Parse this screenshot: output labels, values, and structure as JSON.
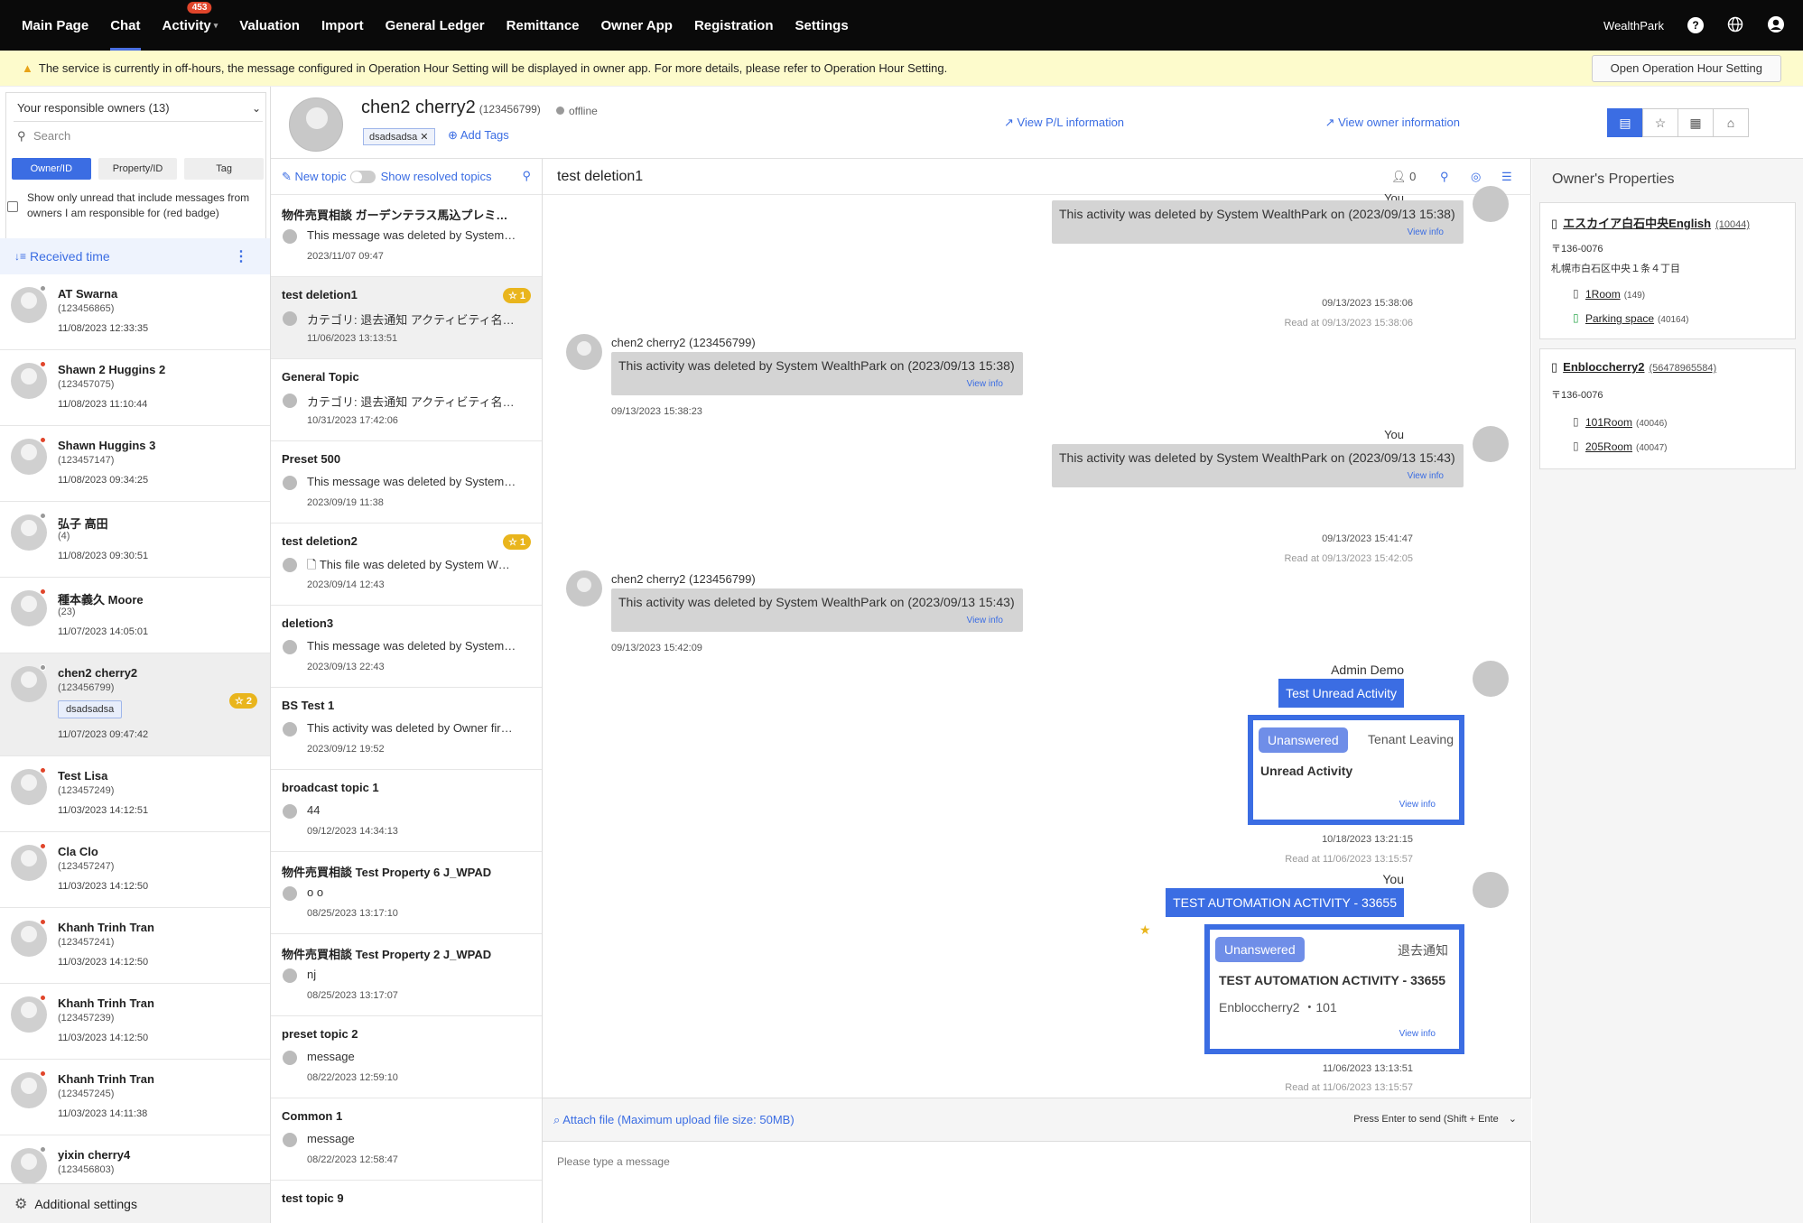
{
  "nav": {
    "items": [
      "Main Page",
      "Chat",
      "Activity",
      "Valuation",
      "Import",
      "General Ledger",
      "Remittance",
      "Owner App",
      "Registration",
      "Settings"
    ],
    "active_index": 1,
    "activity_badge": "453",
    "brand": "WealthPark",
    "help_icon": "question-circle-icon",
    "globe_icon": "globe-icon",
    "user_icon": "user-circle-icon"
  },
  "banner": {
    "text": "The service is currently in off-hours, the message configured in Operation Hour Setting will be displayed in owner app. For more details, please refer to Operation Hour Setting.",
    "button": "Open Operation Hour Setting"
  },
  "filter": {
    "select_value": "Your responsible owners (13)",
    "search_placeholder": "Search",
    "segments": [
      "Owner/ID",
      "Property/ID",
      "Tag"
    ],
    "segment_active": 0,
    "unread_label": "Show only unread that include messages from owners I am responsible for (red badge)",
    "sort_label": "Received time"
  },
  "owners": [
    {
      "name": "AT Swarna",
      "id": "(123456865)",
      "time": "11/08/2023 12:33:35",
      "dot": "grey"
    },
    {
      "name": "Shawn 2 Huggins 2",
      "id": "(123457075)",
      "time": "11/08/2023 11:10:44",
      "dot": "red"
    },
    {
      "name": "Shawn Huggins 3",
      "id": "(123457147)",
      "time": "11/08/2023 09:34:25",
      "dot": "red"
    },
    {
      "name": "弘子 高田",
      "id": "(4)",
      "time": "11/08/2023 09:30:51",
      "dot": "grey"
    },
    {
      "name": "種本義久 Moore",
      "id": "(23)",
      "time": "11/07/2023 14:05:01",
      "dot": "red"
    },
    {
      "name": "chen2 cherry2",
      "id": "(123456799)",
      "time": "11/07/2023 09:47:42",
      "dot": "grey",
      "tag": "dsadsadsa",
      "badge": "2",
      "selected": true
    },
    {
      "name": "Test Lisa",
      "id": "(123457249)",
      "time": "11/03/2023 14:12:51",
      "dot": "red"
    },
    {
      "name": "Cla Clo",
      "id": "(123457247)",
      "time": "11/03/2023 14:12:50",
      "dot": "red"
    },
    {
      "name": "Khanh Trinh Tran",
      "id": "(123457241)",
      "time": "11/03/2023 14:12:50",
      "dot": "red"
    },
    {
      "name": "Khanh Trinh Tran",
      "id": "(123457239)",
      "time": "11/03/2023 14:12:50",
      "dot": "red"
    },
    {
      "name": "Khanh Trinh Tran",
      "id": "(123457245)",
      "time": "11/03/2023 14:11:38",
      "dot": "red"
    },
    {
      "name": "yixin cherry4",
      "id": "(123456803)",
      "time": "",
      "dot": "grey"
    }
  ],
  "additional_settings": "Additional settings",
  "header": {
    "name": "chen2 cherry2",
    "id": "(123456799)",
    "status": "offline",
    "tag": "dsadsadsa",
    "add_tags": "Add Tags",
    "view_pl": "View P/L information",
    "view_owner": "View owner information"
  },
  "topics_bar": {
    "new_topic": "New topic",
    "show_resolved": "Show resolved topics"
  },
  "topics": [
    {
      "title": "物件売買相談 ガーデンテラス馬込プレミ…",
      "msg": "This message was deleted by System…",
      "date": "2023/11/07 09:47"
    },
    {
      "title": "test deletion1",
      "msg": "カテゴリ: 退去通知 アクティビティ名…",
      "date": "11/06/2023 13:13:51",
      "star": "1",
      "selected": true
    },
    {
      "title": "General Topic",
      "msg": "カテゴリ: 退去通知 アクティビティ名…",
      "date": "10/31/2023 17:42:06"
    },
    {
      "title": "Preset 500",
      "msg": "This message was deleted by System…",
      "date": "2023/09/19 11:38"
    },
    {
      "title": "test deletion2",
      "msg": "This file was deleted by System W…",
      "date": "2023/09/14 12:43",
      "star": "1",
      "file": true
    },
    {
      "title": "deletion3",
      "msg": "This message was deleted by System…",
      "date": "2023/09/13 22:43"
    },
    {
      "title": "BS Test 1",
      "msg": "This activity was deleted by Owner fir…",
      "date": "2023/09/12 19:52"
    },
    {
      "title": "broadcast topic 1",
      "msg": "44",
      "date": "09/12/2023 14:34:13"
    },
    {
      "title": "物件売買相談 Test Property 6 J_WPAD",
      "msg": "o o",
      "date": "08/25/2023 13:17:10"
    },
    {
      "title": "物件売買相談 Test Property 2 J_WPAD",
      "msg": "nj",
      "date": "08/25/2023 13:17:07"
    },
    {
      "title": "preset topic 2",
      "msg": "message",
      "date": "08/22/2023 12:59:10"
    },
    {
      "title": "Common 1",
      "msg": "message",
      "date": "08/22/2023 12:58:47"
    },
    {
      "title": "test topic 9",
      "msg": "",
      "date": ""
    }
  ],
  "chat": {
    "title": "test deletion1",
    "participants": "0",
    "view_info": "View info",
    "you": "You",
    "sender": "chen2 cherry2 (123456799)",
    "msg_deleted_1": "This activity was deleted by System WealthPark on (2023/09/13 15:38)",
    "msg_deleted_2": "This activity was deleted by System WealthPark on (2023/09/13 15:43)",
    "ts_1": "09/13/2023 15:38:06",
    "read_1": "Read at 09/13/2023 15:38:06",
    "ts_2": "09/13/2023 15:38:23",
    "ts_3": "09/13/2023 15:41:47",
    "read_3": "Read at 09/13/2023 15:42:05",
    "ts_4": "09/13/2023 15:42:09",
    "admin": "Admin Demo",
    "activity_1": "Test Unread Activity",
    "card_1_status": "Unanswered",
    "card_1_category": "Tenant Leaving",
    "card_1_title": "Unread Activity",
    "ts_5": "10/18/2023 13:21:15",
    "read_5": "Read at 11/06/2023 13:15:57",
    "activity_2": "TEST AUTOMATION ACTIVITY - 33655",
    "card_2_status": "Unanswered",
    "card_2_category": "退去通知",
    "card_2_title": "TEST AUTOMATION ACTIVITY - 33655",
    "card_2_property": "Enbloccherry2 ・101",
    "ts_6": "11/06/2023 13:13:51",
    "read_6": "Read at 11/06/2023 13:15:57",
    "attach": "Attach file (Maximum upload file size: 50MB)",
    "enter_hint": "Press Enter to send (Shift + Ente",
    "placeholder": "Please type a message"
  },
  "properties": {
    "title": "Owner's Properties",
    "list": [
      {
        "name": "エスカイア白石中央English",
        "id": "(10044)",
        "zip": "〒136-0076",
        "addr": "札幌市白石区中央１条４丁目",
        "rooms": [
          {
            "name": "1Room",
            "id": "(149)"
          },
          {
            "name": "Parking space",
            "id": "(40164)"
          }
        ]
      },
      {
        "name": "Enbloccherry2",
        "id": "(56478965584)",
        "zip": "〒136-0076",
        "addr": "",
        "rooms": [
          {
            "name": "101Room",
            "id": "(40046)"
          },
          {
            "name": "205Room",
            "id": "(40047)"
          }
        ]
      }
    ]
  }
}
